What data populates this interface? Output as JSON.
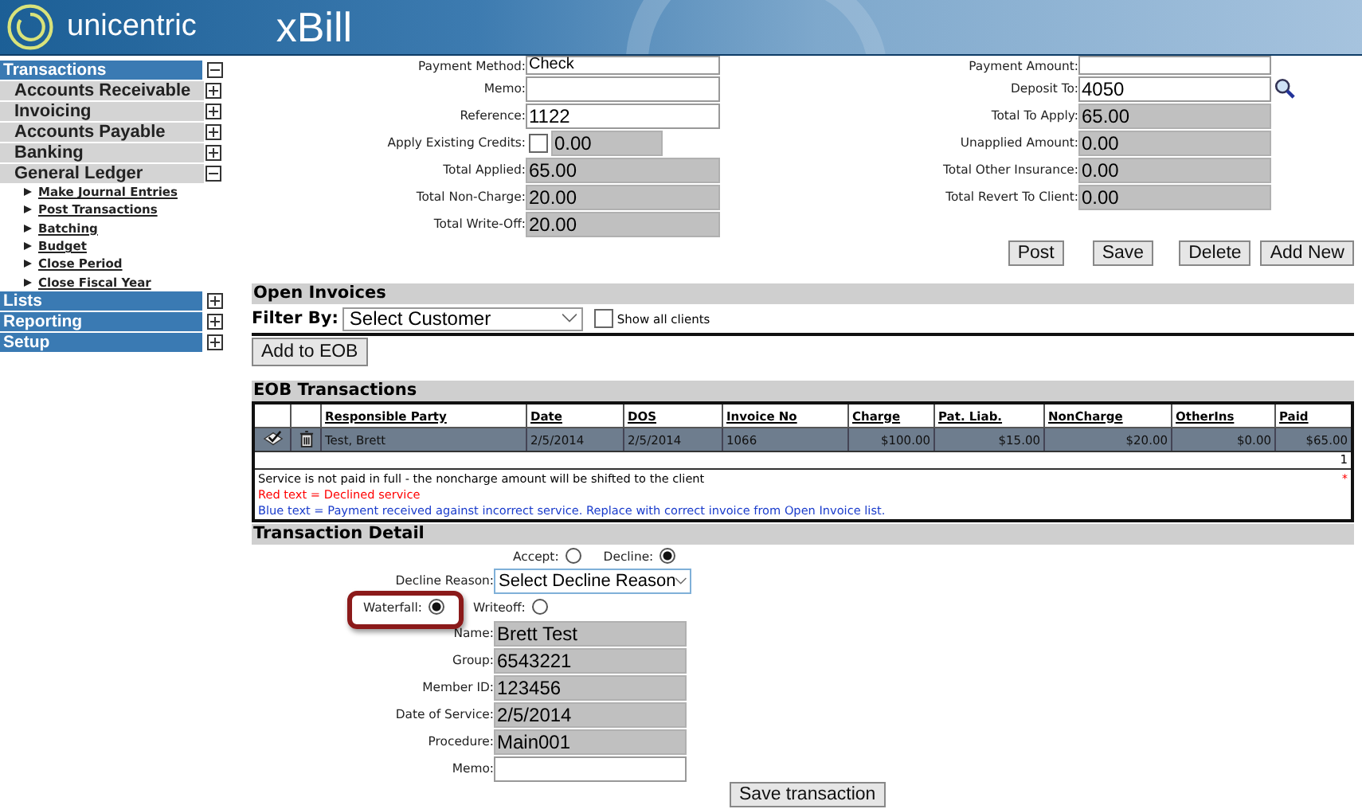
{
  "header": {
    "brand": "unicentric",
    "product": "xBill"
  },
  "sidebar": [
    {
      "label": "Transactions",
      "expanded": true,
      "children": [
        {
          "label": "Accounts Receivable",
          "expanded": false
        },
        {
          "label": "Invoicing",
          "expanded": false
        },
        {
          "label": "Accounts Payable",
          "expanded": false
        },
        {
          "label": "Banking",
          "expanded": false
        },
        {
          "label": "General Ledger",
          "expanded": true,
          "children": [
            {
              "label": "Make Journal Entries"
            },
            {
              "label": "Post Transactions"
            },
            {
              "label": "Batching"
            },
            {
              "label": "Budget"
            },
            {
              "label": "Close Period"
            },
            {
              "label": "Close Fiscal Year"
            }
          ]
        }
      ]
    },
    {
      "label": "Lists",
      "expanded": false
    },
    {
      "label": "Reporting",
      "expanded": false
    },
    {
      "label": "Setup",
      "expanded": false
    }
  ],
  "payment": {
    "left": [
      {
        "label": "Payment Method:",
        "value": "Check",
        "kind": "select"
      },
      {
        "label": "Memo:",
        "kind": "input"
      },
      {
        "label": "Reference:",
        "value": "1122",
        "kind": "input"
      },
      {
        "label": "Apply Existing Credits:",
        "value": "0.00",
        "kind": "credit",
        "checked": false
      },
      {
        "label": "Total Applied:",
        "value": "65.00",
        "kind": "readonly"
      },
      {
        "label": "Total Non-Charge:",
        "value": "20.00",
        "kind": "readonly"
      },
      {
        "label": "Total Write-Off:",
        "value": "20.00",
        "kind": "readonly"
      }
    ],
    "right": [
      {
        "label": "Payment Amount:",
        "kind": "input"
      },
      {
        "label": "Deposit To:",
        "value": "4050",
        "kind": "lookup"
      },
      {
        "label": "Total To Apply:",
        "value": "65.00",
        "kind": "readonly"
      },
      {
        "label": "Unapplied Amount:",
        "value": "0.00",
        "kind": "readonly"
      },
      {
        "label": "Total Other Insurance:",
        "value": "0.00",
        "kind": "readonly"
      },
      {
        "label": "Total Revert To Client:",
        "value": "0.00",
        "kind": "readonly"
      }
    ],
    "buttons": [
      "Post",
      "Save",
      "Delete",
      "Add New"
    ]
  },
  "open_invoices": {
    "title": "Open Invoices",
    "filter_label": "Filter By:",
    "filter_value": "Select Customer",
    "show_all": {
      "label": "Show all clients",
      "checked": false
    },
    "button": "Add to EOB"
  },
  "eob": {
    "title": "EOB Transactions",
    "columns": [
      "Responsible Party",
      "Date",
      "DOS",
      "Invoice No",
      "Charge",
      "Pat. Liab.",
      "NonCharge",
      "OtherIns",
      "Paid"
    ],
    "rows": [
      {
        "cells": [
          "Test, Brett",
          "2/5/2014",
          "2/5/2014",
          "1066",
          "$100.00",
          "$15.00",
          "$20.00",
          "$0.00",
          "$65.00"
        ],
        "selected": true
      }
    ],
    "page": "1",
    "marker": "*",
    "notes": [
      {
        "text": "Service is not paid in full - the noncharge amount will be shifted to the client",
        "kind": "plain"
      },
      {
        "text": "Red text = Declined service",
        "kind": "red"
      },
      {
        "text": "Blue text = Payment received against incorrect service. Replace with correct invoice from Open Invoice list.",
        "kind": "blue"
      }
    ]
  },
  "detail": {
    "title": "Transaction Detail",
    "decision": [
      {
        "label": "Accept:",
        "selected": false
      },
      {
        "label": "Decline:",
        "selected": true
      }
    ],
    "reason_label": "Decline Reason:",
    "reason_value": "Select Decline Reason",
    "method": [
      {
        "label": "Waterfall:",
        "selected": true,
        "highlighted": true
      },
      {
        "label": "Writeoff:",
        "selected": false,
        "highlighted": false
      }
    ],
    "fields": [
      {
        "label": "Name:",
        "value": "Brett  Test",
        "kind": "readonly"
      },
      {
        "label": "Group:",
        "value": "6543221",
        "kind": "readonly"
      },
      {
        "label": "Member ID:",
        "value": "123456",
        "kind": "readonly"
      },
      {
        "label": "Date of Service:",
        "value": "2/5/2014",
        "kind": "readonly"
      },
      {
        "label": "Procedure:",
        "value": "Main001",
        "kind": "readonly"
      },
      {
        "label": "Memo:",
        "kind": "input"
      }
    ],
    "button": "Save transaction"
  }
}
